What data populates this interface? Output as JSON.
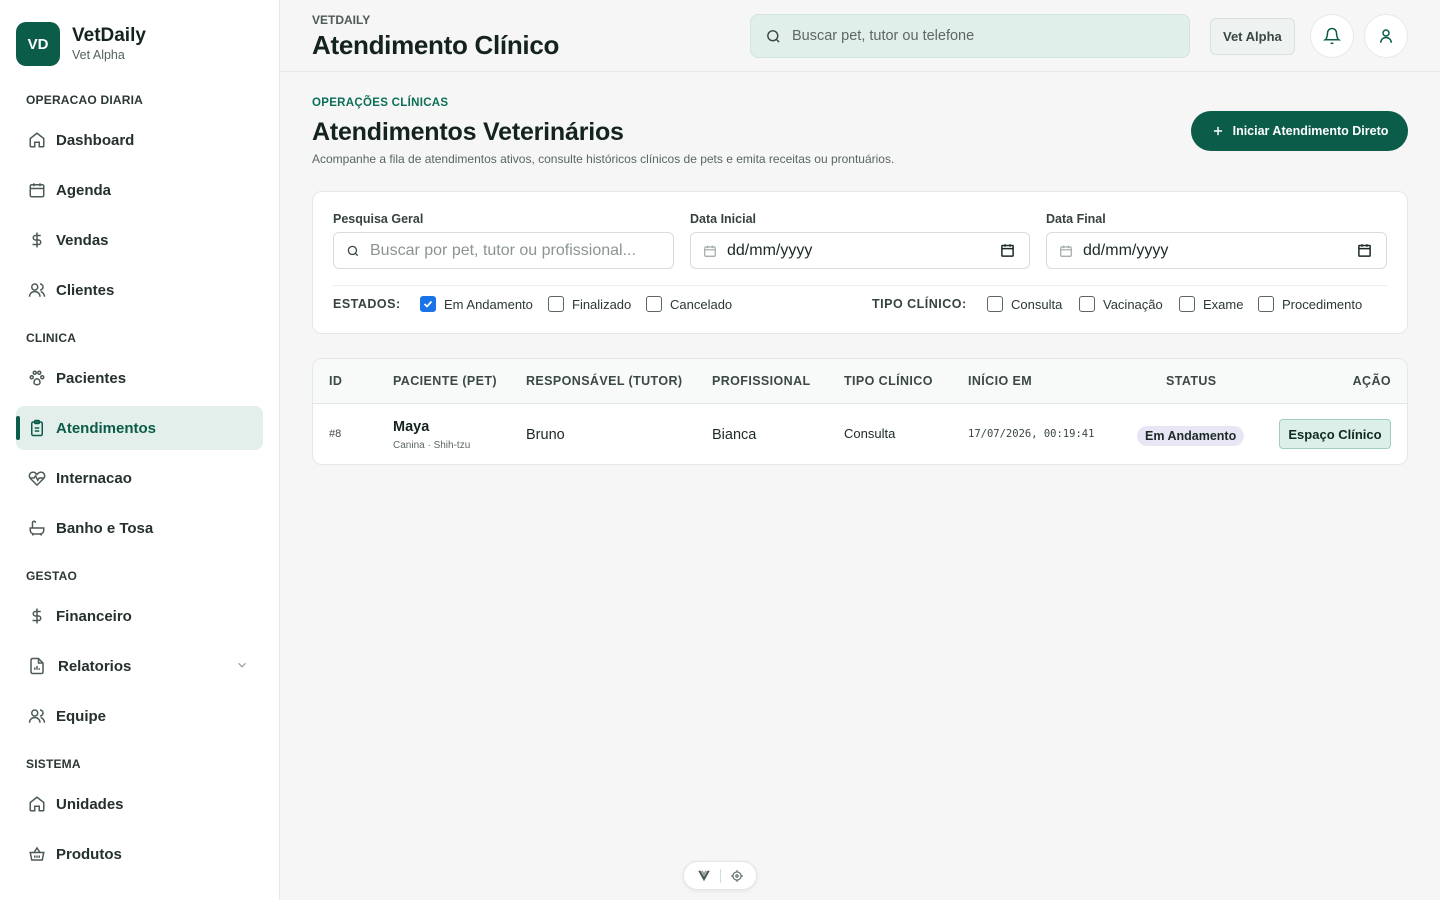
{
  "brand": {
    "initials": "VD",
    "name": "VetDaily",
    "subtitle": "Vet Alpha"
  },
  "sidebar": {
    "sections": [
      {
        "label": "OPERACAO DIARIA"
      },
      {
        "label": "CLINICA"
      },
      {
        "label": "GESTAO"
      },
      {
        "label": "SISTEMA"
      }
    ],
    "items": [
      {
        "label": "Dashboard",
        "icon": "home-icon"
      },
      {
        "label": "Agenda",
        "icon": "calendar-icon"
      },
      {
        "label": "Vendas",
        "icon": "dollar-icon"
      },
      {
        "label": "Clientes",
        "icon": "users-icon"
      },
      {
        "label": "Pacientes",
        "icon": "paw-icon"
      },
      {
        "label": "Atendimentos",
        "icon": "clipboard-icon",
        "active": true
      },
      {
        "label": "Internacao",
        "icon": "heart-pulse-icon"
      },
      {
        "label": "Banho e Tosa",
        "icon": "bath-icon"
      },
      {
        "label": "Financeiro",
        "icon": "dollar-icon"
      },
      {
        "label": "Relatorios",
        "icon": "report-icon"
      },
      {
        "label": "Equipe",
        "icon": "users-icon"
      },
      {
        "label": "Unidades",
        "icon": "home-icon"
      },
      {
        "label": "Produtos",
        "icon": "basket-icon"
      }
    ]
  },
  "header": {
    "breadcrumb": "VETDAILY",
    "title": "Atendimento Clínico",
    "search_placeholder": "Buscar pet, tutor ou telefone",
    "unit_label": "Vet Alpha"
  },
  "main": {
    "eyebrow": "OPERAÇÕES CLÍNICAS",
    "title": "Atendimentos Veterinários",
    "description": "Acompanhe a fila de atendimentos ativos, consulte históricos clínicos de pets e emita receitas ou prontuários.",
    "primary_button": "Iniciar Atendimento Direto"
  },
  "filters": {
    "search_label": "Pesquisa Geral",
    "search_placeholder": "Buscar por pet, tutor ou profissional...",
    "start_label": "Data Inicial",
    "start_placeholder": "dd/mm/yyyy",
    "end_label": "Data Final",
    "end_placeholder": "dd/mm/yyyy",
    "states_label": "ESTADOS:",
    "states": [
      {
        "label": "Em Andamento",
        "checked": true
      },
      {
        "label": "Finalizado",
        "checked": false
      },
      {
        "label": "Cancelado",
        "checked": false
      }
    ],
    "types_label": "TIPO CLÍNICO:",
    "types": [
      {
        "label": "Consulta",
        "checked": false
      },
      {
        "label": "Vacinação",
        "checked": false
      },
      {
        "label": "Exame",
        "checked": false
      },
      {
        "label": "Procedimento",
        "checked": false
      }
    ]
  },
  "table": {
    "columns": [
      "ID",
      "PACIENTE (PET)",
      "RESPONSÁVEL (TUTOR)",
      "PROFISSIONAL",
      "TIPO CLÍNICO",
      "INÍCIO EM",
      "STATUS",
      "AÇÃO"
    ],
    "rows": [
      {
        "id": "#8",
        "pet": "Maya",
        "pet_details": "Canina · Shih-tzu",
        "tutor": "Bruno",
        "professional": "Bianca",
        "type": "Consulta",
        "started_at": "17/07/2026, 00:19:41",
        "status": "Em Andamento",
        "action": "Espaço Clínico"
      }
    ]
  },
  "colors": {
    "brand": "#0c5c4a",
    "accent_soft": "#e2efea",
    "checkbox": "#1a73e8"
  }
}
